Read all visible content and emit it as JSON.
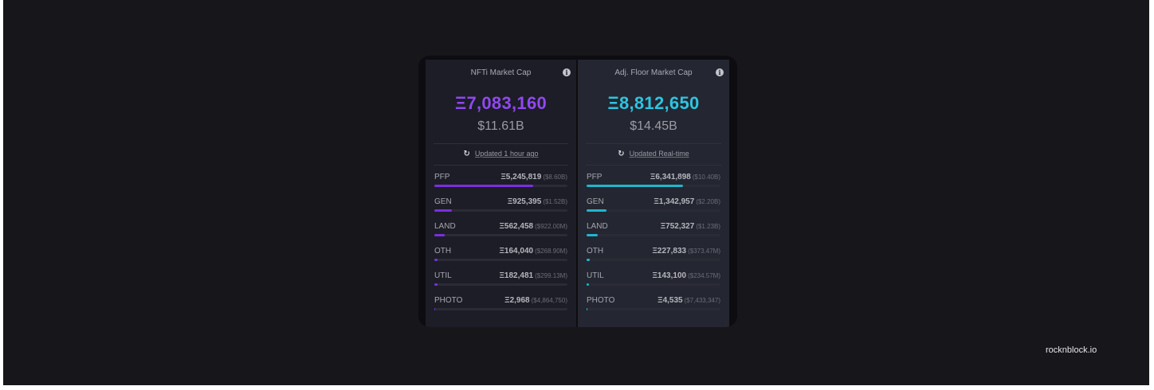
{
  "brand": "rocknblock.io",
  "colors": {
    "background": "#17161b",
    "nfti_accent": "#9048f0",
    "floor_accent": "#2cc5e0"
  },
  "panels": [
    {
      "title": "NFTi Market Cap",
      "info_icon": "info-icon",
      "eth_value": "Ξ7,083,160",
      "usd_value": "$11.61B",
      "reload_icon": "refresh-icon",
      "updated_text": "Updated 1 hour ago",
      "rows": [
        {
          "category": "PFP",
          "eth": "Ξ5,245,819",
          "usd": "($8.60B)",
          "share": 0.74
        },
        {
          "category": "GEN",
          "eth": "Ξ925,395",
          "usd": "($1.52B)",
          "share": 0.13
        },
        {
          "category": "LAND",
          "eth": "Ξ562,458",
          "usd": "($922.00M)",
          "share": 0.08
        },
        {
          "category": "OTH",
          "eth": "Ξ164,040",
          "usd": "($268.90M)",
          "share": 0.025
        },
        {
          "category": "UTIL",
          "eth": "Ξ182,481",
          "usd": "($299.13M)",
          "share": 0.026
        },
        {
          "category": "PHOTO",
          "eth": "Ξ2,968",
          "usd": "($4,864,750)",
          "share": 0.004
        }
      ]
    },
    {
      "title": "Adj. Floor Market Cap",
      "info_icon": "info-icon",
      "eth_value": "Ξ8,812,650",
      "usd_value": "$14.45B",
      "reload_icon": "refresh-icon",
      "updated_text": "Updated Real-time",
      "rows": [
        {
          "category": "PFP",
          "eth": "Ξ6,341,898",
          "usd": "($10.40B)",
          "share": 0.72
        },
        {
          "category": "GEN",
          "eth": "Ξ1,342,957",
          "usd": "($2.20B)",
          "share": 0.15
        },
        {
          "category": "LAND",
          "eth": "Ξ752,327",
          "usd": "($1.23B)",
          "share": 0.085
        },
        {
          "category": "OTH",
          "eth": "Ξ227,833",
          "usd": "($373.47M)",
          "share": 0.026
        },
        {
          "category": "UTIL",
          "eth": "Ξ143,100",
          "usd": "($234.57M)",
          "share": 0.016
        },
        {
          "category": "PHOTO",
          "eth": "Ξ4,535",
          "usd": "($7,433,347)",
          "share": 0.005
        }
      ]
    }
  ]
}
